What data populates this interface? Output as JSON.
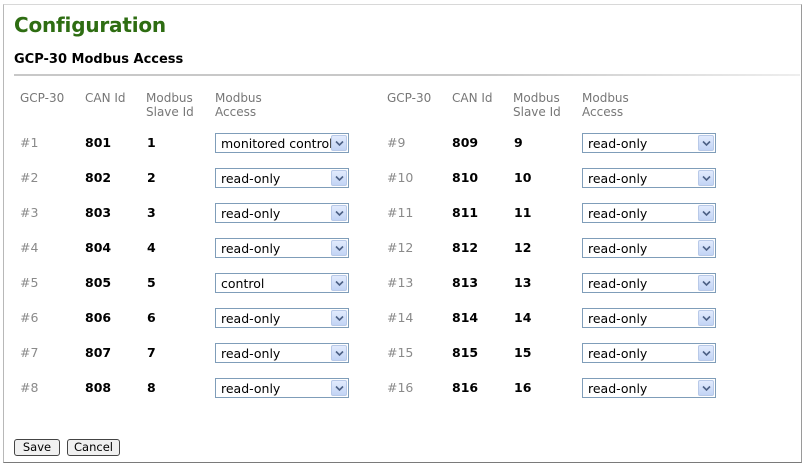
{
  "page_title": "Configuration",
  "section_title": "GCP-30 Modbus Access",
  "headers": {
    "gcp": "GCP-30",
    "can_id": "CAN Id",
    "slave_id": "Modbus Slave Id",
    "access": "Modbus Access"
  },
  "rows": [
    {
      "num": "#1",
      "can_id": "801",
      "slave_id": "1",
      "access": "monitored control"
    },
    {
      "num": "#2",
      "can_id": "802",
      "slave_id": "2",
      "access": "read-only"
    },
    {
      "num": "#3",
      "can_id": "803",
      "slave_id": "3",
      "access": "read-only"
    },
    {
      "num": "#4",
      "can_id": "804",
      "slave_id": "4",
      "access": "read-only"
    },
    {
      "num": "#5",
      "can_id": "805",
      "slave_id": "5",
      "access": "control"
    },
    {
      "num": "#6",
      "can_id": "806",
      "slave_id": "6",
      "access": "read-only"
    },
    {
      "num": "#7",
      "can_id": "807",
      "slave_id": "7",
      "access": "read-only"
    },
    {
      "num": "#8",
      "can_id": "808",
      "slave_id": "8",
      "access": "read-only"
    },
    {
      "num": "#9",
      "can_id": "809",
      "slave_id": "9",
      "access": "read-only"
    },
    {
      "num": "#10",
      "can_id": "810",
      "slave_id": "10",
      "access": "read-only"
    },
    {
      "num": "#11",
      "can_id": "811",
      "slave_id": "11",
      "access": "read-only"
    },
    {
      "num": "#12",
      "can_id": "812",
      "slave_id": "12",
      "access": "read-only"
    },
    {
      "num": "#13",
      "can_id": "813",
      "slave_id": "13",
      "access": "read-only"
    },
    {
      "num": "#14",
      "can_id": "814",
      "slave_id": "14",
      "access": "read-only"
    },
    {
      "num": "#15",
      "can_id": "815",
      "slave_id": "15",
      "access": "read-only"
    },
    {
      "num": "#16",
      "can_id": "816",
      "slave_id": "16",
      "access": "read-only"
    }
  ],
  "buttons": {
    "save": "Save",
    "cancel": "Cancel"
  },
  "colors": {
    "title": "#2e6d12",
    "muted_text": "#8a8a8a",
    "select_border": "#7f9db9"
  }
}
